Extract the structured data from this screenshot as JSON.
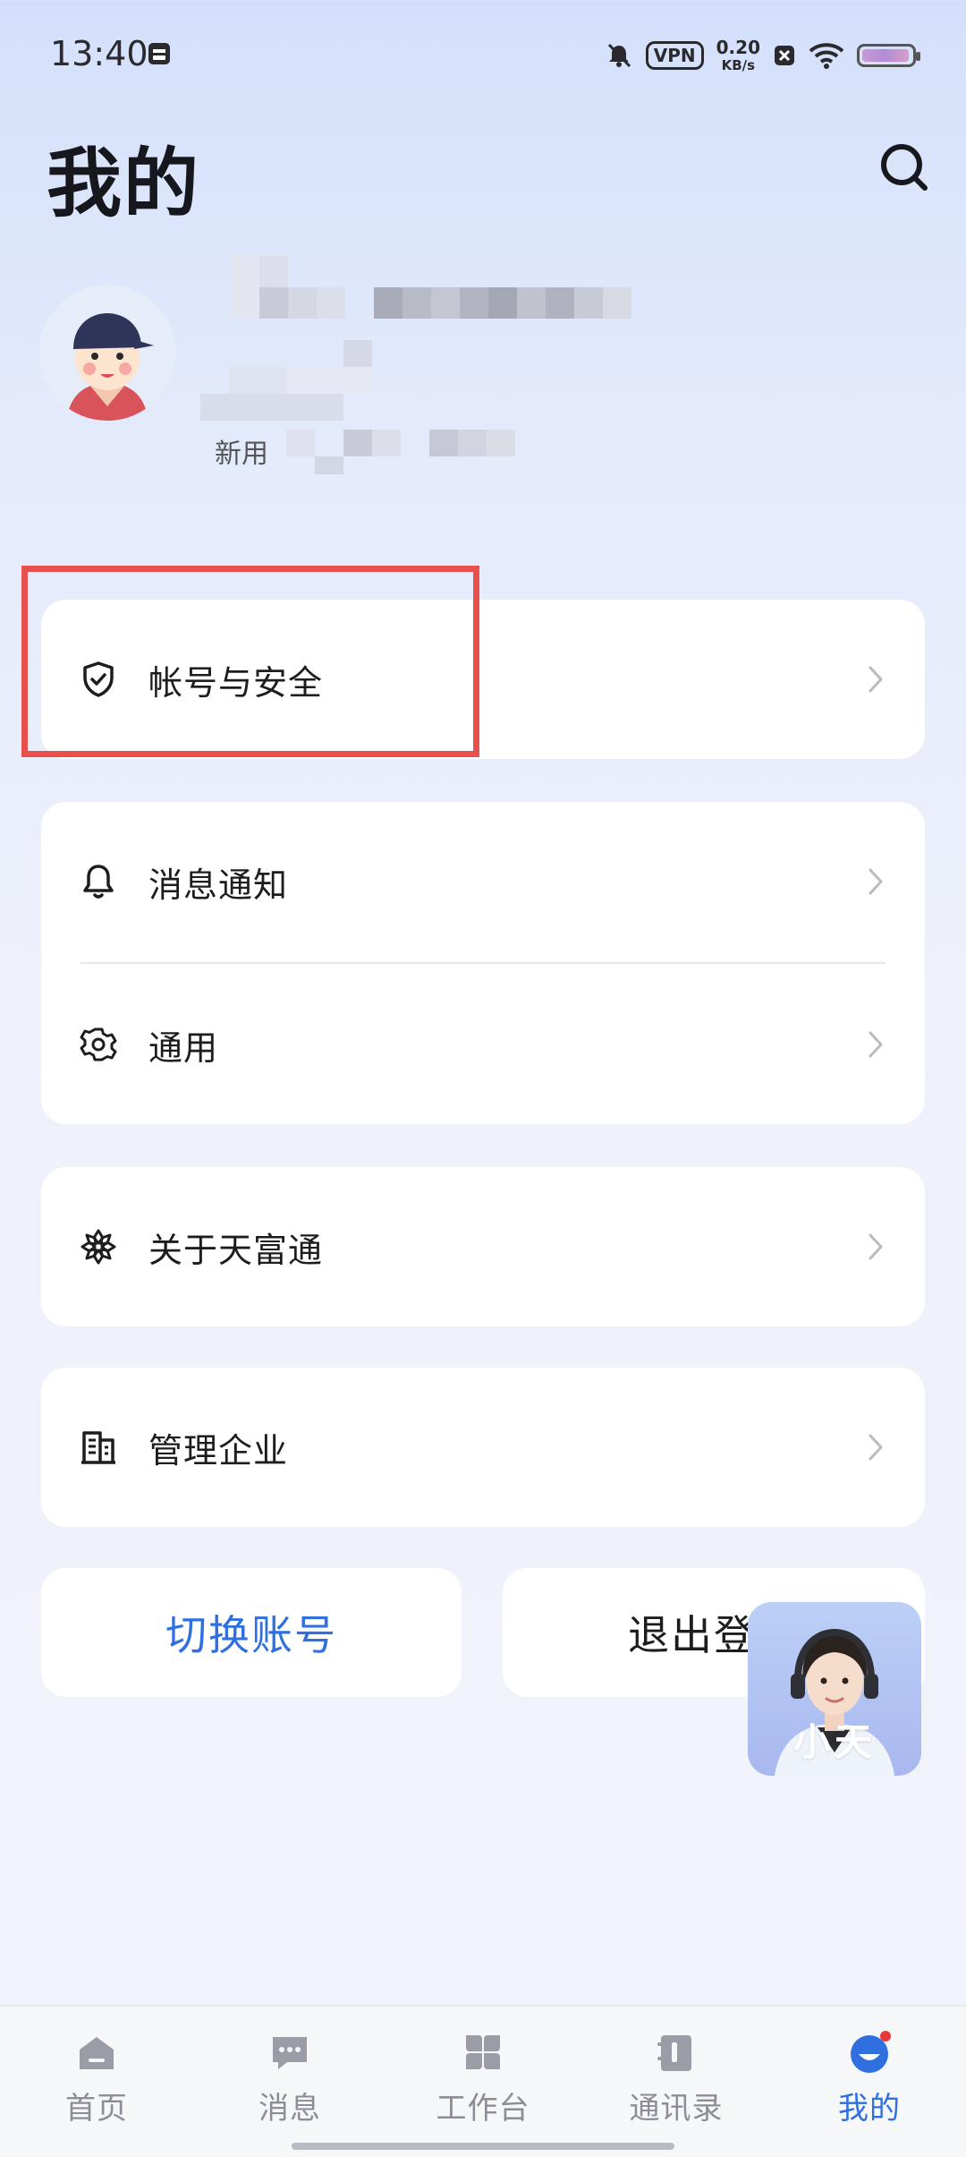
{
  "status_bar": {
    "time": "13:40",
    "vpn": "VPN",
    "speed_value": "0.20",
    "speed_unit": "KB/s"
  },
  "header": {
    "title": "我的"
  },
  "profile": {
    "subtitle": "新用"
  },
  "menu": {
    "account_security": "帐号与安全",
    "notifications": "消息通知",
    "general": "通用",
    "about": "关于天富通",
    "manage_enterprise": "管理企业"
  },
  "actions": {
    "switch_account": "切换账号",
    "logout": "退出登"
  },
  "assistant": {
    "label": "小天"
  },
  "bottom_nav": {
    "tabs": [
      "首页",
      "消息",
      "工作台",
      "通讯录",
      "我的"
    ],
    "active": "我的"
  },
  "colors": {
    "accent": "#2f6fe0",
    "highlight": "#e8504d",
    "badge": "#e8393a"
  }
}
